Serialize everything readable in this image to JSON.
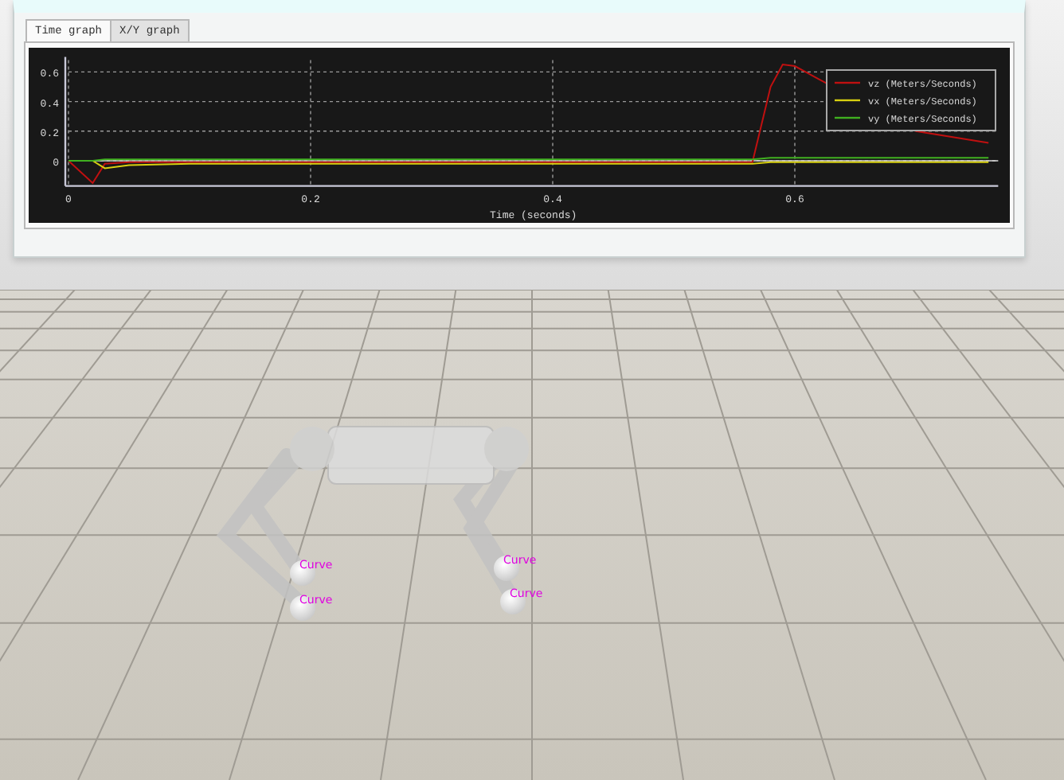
{
  "graph_window": {
    "tabs": [
      {
        "label": "Time graph",
        "selected": true
      },
      {
        "label": "X/Y graph",
        "selected": false
      }
    ],
    "chart_data": {
      "type": "line",
      "xlabel": "Time (seconds)",
      "xlim": [
        0,
        0.768
      ],
      "ylim": [
        -0.17,
        0.68
      ],
      "xticks": [
        0,
        0.2,
        0.4,
        0.6
      ],
      "yticks": [
        0,
        0.2,
        0.4,
        0.6
      ],
      "grid": true,
      "legend": true,
      "x": [
        0,
        0.02,
        0.03,
        0.05,
        0.1,
        0.2,
        0.3,
        0.4,
        0.5,
        0.565,
        0.58,
        0.59,
        0.6,
        0.62,
        0.7,
        0.76
      ],
      "series": [
        {
          "name": "vz (Meters/Seconds)",
          "color": "#c01010",
          "values": [
            0,
            -0.15,
            -0.02,
            -0.01,
            -0.01,
            -0.01,
            -0.01,
            -0.01,
            -0.01,
            -0.01,
            0.5,
            0.65,
            0.64,
            0.55,
            0.2,
            0.12
          ]
        },
        {
          "name": "vx (Meters/Seconds)",
          "color": "#d8d010",
          "values": [
            0,
            0,
            -0.05,
            -0.03,
            -0.02,
            -0.02,
            -0.02,
            -0.02,
            -0.02,
            -0.02,
            -0.01,
            -0.01,
            -0.01,
            -0.01,
            -0.01,
            -0.01
          ]
        },
        {
          "name": "vy (Meters/Seconds)",
          "color": "#40b020",
          "values": [
            0,
            0,
            0.01,
            0.01,
            0.01,
            0.01,
            0.01,
            0.01,
            0.01,
            0.01,
            0.02,
            0.02,
            0.02,
            0.02,
            0.02,
            0.02
          ]
        }
      ]
    }
  },
  "scene": {
    "foot_labels": [
      "Curve",
      "Curve",
      "Curve",
      "Curve"
    ]
  }
}
